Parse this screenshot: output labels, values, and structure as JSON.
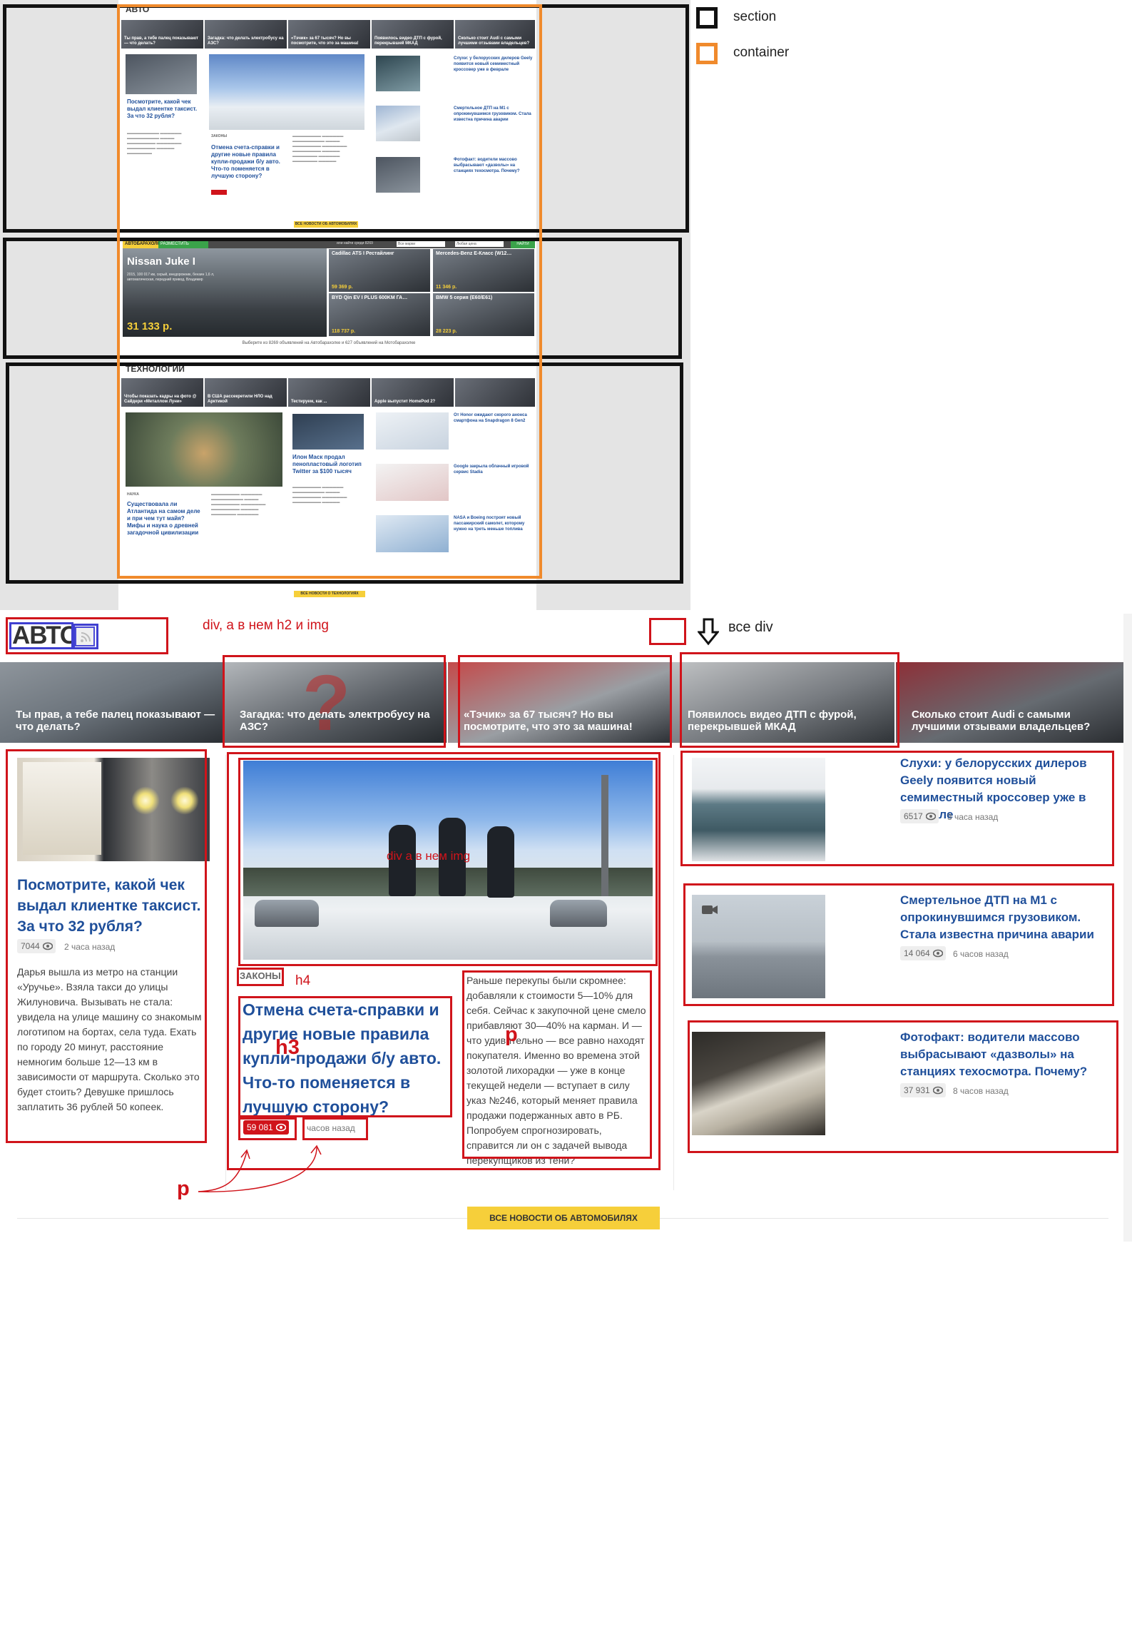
{
  "legend": {
    "section": "section",
    "container": "container"
  },
  "overview": {
    "auto_title": "АВТО",
    "tech_title": "ТЕХНОЛОГИИ",
    "strip": [
      "Ты прав, а тебе палец показывают — что делать?",
      "Загадка: что делать электробусу на АЗС?",
      "«Тэчик» за 67 тысяч? Но вы посмотрите, что это за машина!",
      "Появилось видео ДТП с фурой, перекрывшей МКАД",
      "Сколько стоит Audi с самыми лучшими отзывами владельцев?"
    ],
    "left_head": "Посмотрите, какой чек выдал клиентке таксист. За что 32 рубля?",
    "main_tag": "ЗАКОНЫ",
    "main_head": "Отмена счета-справки и другие новые правила купли-продажи б/у авто. Что-то поменяется в лучшую сторону?",
    "right_items": [
      "Слухи: у белорусских дилеров Geely появится новый семиместный кроссовер уже в феврале",
      "Смертельное ДТП на М1 с опрокинувшимся грузовиком. Стала известна причина аварии",
      "Фотофакт: водители массово выбрасывают «дазволы» на станциях техосмотра. Почему?"
    ],
    "all_auto": "ВСЕ НОВОСТИ ОБ АВТОМОБИЛЯХ",
    "all_tech": "ВСЕ НОВОСТИ О ТЕХНОЛОГИЯХ",
    "autobar": {
      "brand": "АВТОБАРАХОЛКА",
      "place": "РАЗМЕСТИТЬ ОБЪЯВЛЕНИЕ",
      "hint": "или найти среди 8269",
      "sel1": "Все марки",
      "sel2": "Любая цена",
      "find": "НАЙТИ"
    },
    "auto_big": {
      "title": "Nissan Juke I",
      "desc": "2015, 100 017 км, серый, внедорожник, бензин 1,6 л, автоматическая, передний привод, Владимир",
      "price": "31 133 р."
    },
    "auto_cells": [
      {
        "title": "Cadillac ATS I Рестайлинг",
        "price": "59 369 р."
      },
      {
        "title": "Mercedes-Benz E-Класс (W12…",
        "price": "11 346 р."
      },
      {
        "title": "BYD Qin EV I PLUS 600KM ГА…",
        "price": "118 737 р."
      },
      {
        "title": "BMW 5 серия (E60/E61)",
        "price": "28 223 р."
      }
    ],
    "auto_foot": "Выберите из 8269 объявлений на Автобарахолке и 627 объявлений на Мотобарахолке",
    "tech_strip": [
      "Чтобы показать кадры на фото @ Сайдери «Металлом Луни»",
      "В США рассекретили НЛО над Арктикой",
      "Тестируем, как ...",
      "Apple выпустит HomePod 2?",
      ""
    ],
    "tech_left_tag": "НАУКА",
    "tech_left_head": "Существовала ли Атлантида на самом деле и при чем тут майя? Мифы и наука о древней загадочной цивилизации",
    "tech_mid_head": "Илон Маск продал пенопластовый логотип Twitter за $100 тысяч",
    "tech_right": [
      "От Honor ожидают скорого анонса смартфона на Snapdragon 8 Gen2",
      "Google закрыла облачный игровой сервис Stadia",
      "NASA и Boeing построят новый пассажирский самолет, которому нужно на треть меньше топлива"
    ]
  },
  "annotations": {
    "div_h2_img": "div, а в нем h2 и img",
    "all_div": "все div",
    "div_img": "div а в нем img",
    "h4": "h4",
    "h3": "h3",
    "p1": "p",
    "p2": "p"
  },
  "zoom": {
    "title": "АВТО",
    "strip": [
      "Ты прав, а тебе палец показывают — что делать?",
      "Загадка: что делать электробусу на АЗС?",
      "«Тэчик» за 67 тысяч? Но вы посмотрите, что это за машина!",
      "Появилось видео ДТП с фурой, перекрывшей МКАД",
      "Сколько стоит Audi с самыми лучшими отзывами владельцев?"
    ],
    "left": {
      "headline": "Посмотрите, какой чек выдал клиентке таксист. За что 32 рубля?",
      "views": "7044",
      "time": "2 часа назад",
      "text": "Дарья вышла из метро на станции «Уручье». Взяла такси до улицы Жилуновича. Вызывать не стала: увидела на улице машину со знакомым логотипом на бортах, села туда. Ехать по городу 20 минут, расстояние немногим больше 12—13 км в зависимости от маршрута. Сколько это будет стоить? Девушке пришлось заплатить 36 рублей 50 копеек."
    },
    "main": {
      "tag": "ЗАКОНЫ",
      "headline": "Отмена счета-справки и другие новые правила купли-продажи б/у авто. Что-то поменяется в лучшую сторону?",
      "views": "59 081",
      "time": "часов назад",
      "text": "Раньше перекупы были скромнее: добавляли к стоимости 5—10% для себя. Сейчас к закупочной цене смело прибавляют 30—40% на карман. И — что удивительно — все равно находят покупателя. Именно во времена этой золотой лихорадки — уже в конце текущей недели — вступает в силу указ №246, который меняет правила продажи подержанных авто в РБ. Попробуем спрогнозировать, справится ли он с задачей вывода перекупщиков из тени?"
    },
    "right": [
      {
        "headline": "Слухи: у белорусских дилеров Geely появится новый семиместный кроссовер уже в феврале",
        "views": "6517",
        "time": "3 часа назад"
      },
      {
        "headline": "Смертельное ДТП на М1 с опрокинувшимся грузовиком. Стала известна причина аварии",
        "views": "14 064",
        "time": "6 часов назад"
      },
      {
        "headline": "Фотофакт: водители массово выбрасывают «дазволы» на станциях техосмотра. Почему?",
        "views": "37 931",
        "time": "8 часов назад"
      }
    ],
    "all_news_button": "ВСЕ НОВОСТИ ОБ АВТОМОБИЛЯХ"
  },
  "colors": {
    "accent": "#f6cf3a",
    "link": "#1f4f9a",
    "annotation": "#d0141b",
    "section": "#111111",
    "container": "#f08a2c"
  }
}
